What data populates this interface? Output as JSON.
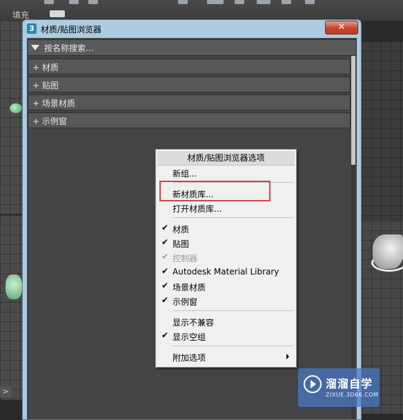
{
  "background": {
    "toolbar_label": "填充",
    "left_arrow": ">"
  },
  "dialog": {
    "app_icon": "3",
    "title": "材质/贴图浏览器",
    "close_label": "✕",
    "search_placeholder": "按名称搜索...",
    "rollouts": [
      {
        "label": "+ 材质"
      },
      {
        "label": "+ 贴图"
      },
      {
        "label": "+ 场景材质"
      },
      {
        "label": "+ 示例窗"
      }
    ]
  },
  "context_menu": {
    "header": "材质/贴图浏览器选项",
    "items": [
      {
        "label": "新组...",
        "checked": false,
        "disabled": false
      },
      {
        "label": "新材质库...",
        "checked": false,
        "disabled": false
      },
      {
        "label": "打开材质库...",
        "checked": false,
        "disabled": false
      },
      {
        "label": "材质",
        "checked": true,
        "disabled": false
      },
      {
        "label": "贴图",
        "checked": true,
        "disabled": false
      },
      {
        "label": "控制器",
        "checked": true,
        "disabled": true
      },
      {
        "label": "Autodesk Material Library",
        "checked": true,
        "disabled": false
      },
      {
        "label": "场景材质",
        "checked": true,
        "disabled": false
      },
      {
        "label": "示例窗",
        "checked": true,
        "disabled": false
      },
      {
        "label": "显示不兼容",
        "checked": false,
        "disabled": false
      },
      {
        "label": "显示空组",
        "checked": true,
        "disabled": false
      },
      {
        "label": "附加选项",
        "checked": false,
        "disabled": false,
        "submenu": true
      }
    ],
    "check_glyph": "✔"
  },
  "watermark": {
    "title": "溜溜自学",
    "subtitle": "ZIXUE.3D66.COM"
  },
  "colors": {
    "highlight": "#d9433a",
    "titlebar": "#aecbe0",
    "panel": "#444444"
  }
}
